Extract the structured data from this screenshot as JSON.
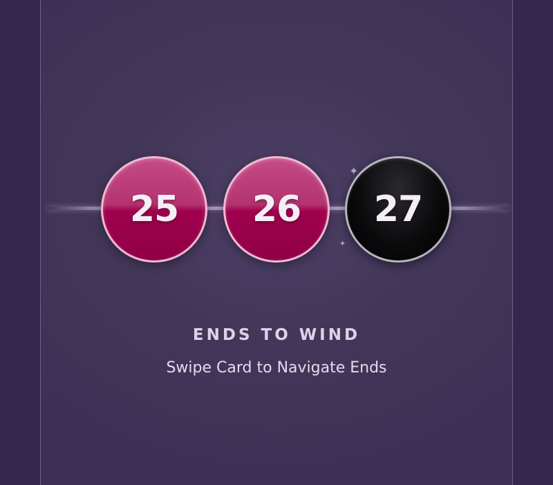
{
  "ends": [
    {
      "number": "25",
      "status": "completed",
      "color": "#a0004e"
    },
    {
      "number": "26",
      "status": "completed",
      "color": "#a0004e"
    },
    {
      "number": "27",
      "status": "current",
      "color": "#000000"
    }
  ],
  "heading": "ENDS TO WIND",
  "instruction": "Swipe Card to Navigate Ends",
  "colors": {
    "background": "#392c55",
    "card": "#433759",
    "completed_end": "#a0004e",
    "current_end": "#000000",
    "text": "#dcd3e8"
  },
  "icons": [
    "sparkle-icon"
  ]
}
